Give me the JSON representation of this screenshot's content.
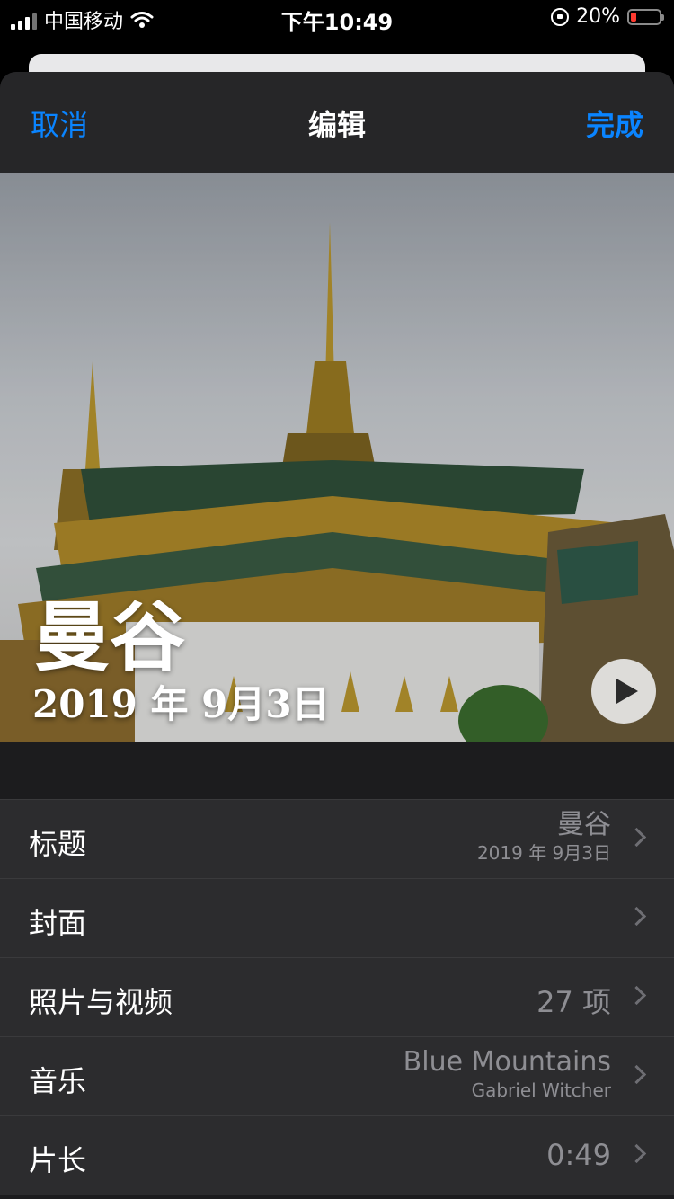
{
  "status_bar": {
    "carrier": "中国移动",
    "time": "下午10:49",
    "battery": "20%",
    "battery_level": 0.2
  },
  "nav": {
    "cancel": "取消",
    "title": "编辑",
    "done": "完成"
  },
  "memory": {
    "title": "曼谷",
    "date": "2019 年 9月3日"
  },
  "rows": [
    {
      "label": "标题",
      "value": "曼谷",
      "subvalue": "2019 年 9月3日"
    },
    {
      "label": "封面",
      "value": ""
    },
    {
      "label": "照片与视频",
      "value": "27 项"
    },
    {
      "label": "音乐",
      "value": "Blue Mountains",
      "subvalue": "Gabriel Witcher"
    },
    {
      "label": "片长",
      "value": "0:49"
    }
  ],
  "colors": {
    "accent": "#0a84ff",
    "sheet_bg": "#1c1c1e",
    "row_bg": "#2c2c2e",
    "secondary_text": "#8e8e93"
  },
  "icons": [
    "signal-icon",
    "wifi-icon",
    "orientation-lock-icon",
    "battery-icon",
    "play-icon",
    "chevron-right-icon"
  ]
}
